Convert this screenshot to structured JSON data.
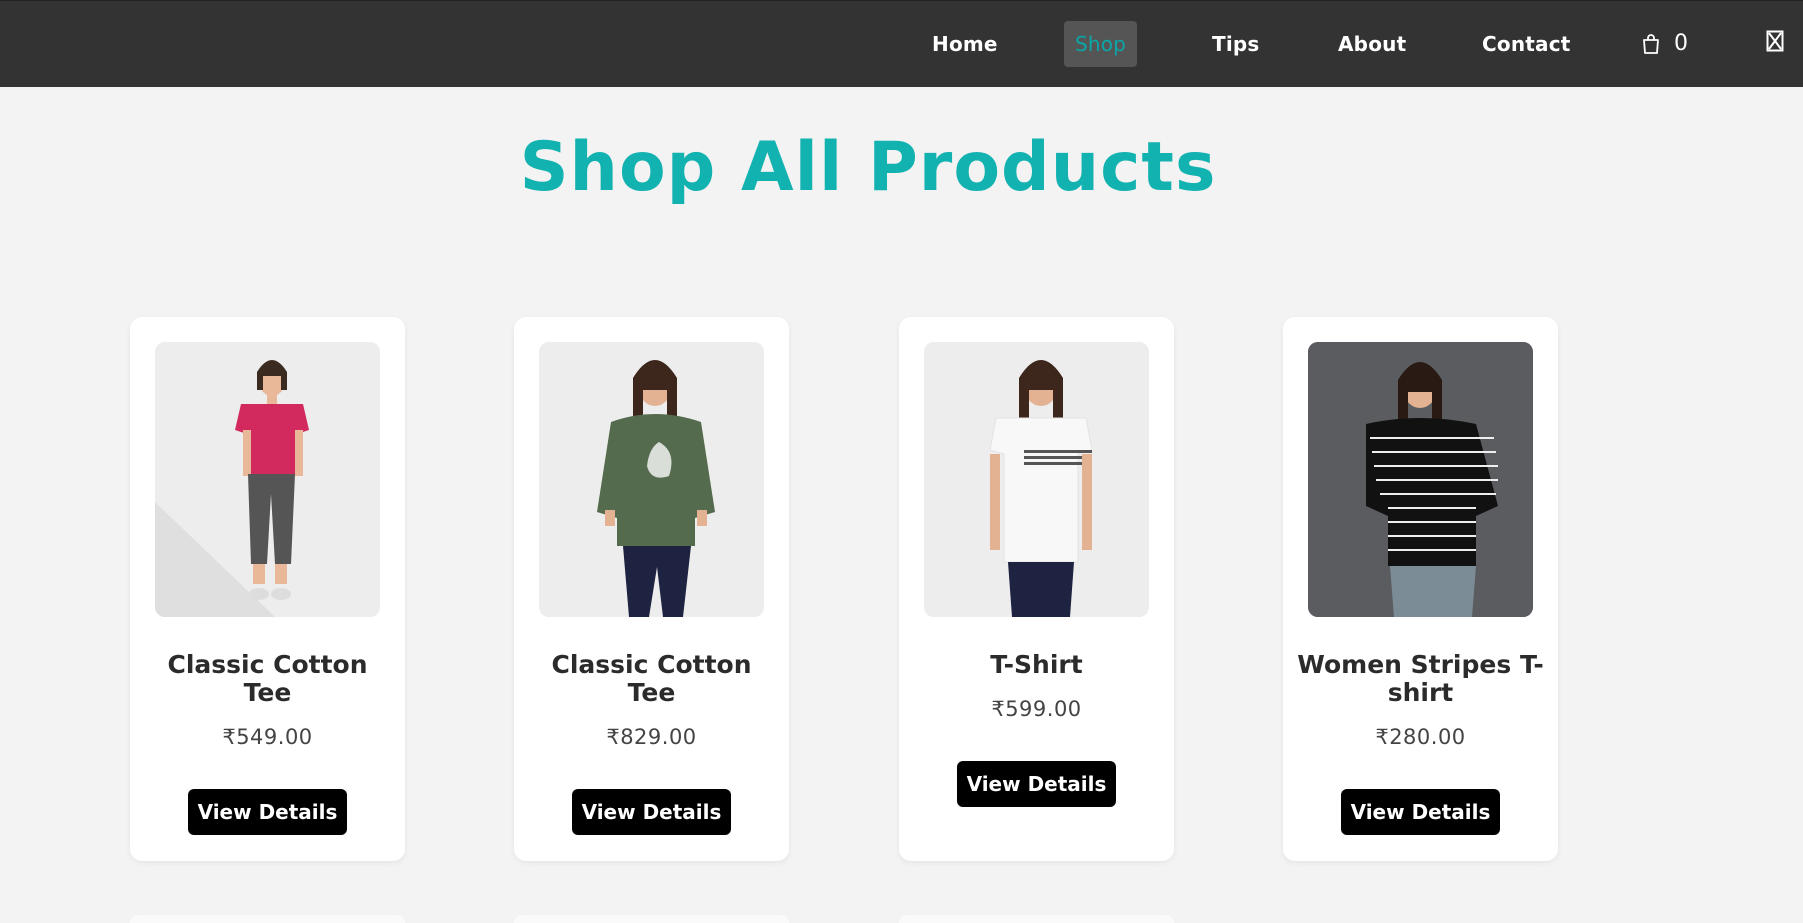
{
  "nav": {
    "items": [
      {
        "label": "Home",
        "active": false
      },
      {
        "label": "Shop",
        "active": true
      },
      {
        "label": "Tips",
        "active": false
      },
      {
        "label": "About",
        "active": false
      },
      {
        "label": "Contact",
        "active": false
      }
    ],
    "cart_count": "0",
    "cart_icon": "shopping-bag-icon",
    "close_icon": "close-icon"
  },
  "page": {
    "title": "Shop All Products"
  },
  "products": [
    {
      "name": "Classic Cotton Tee",
      "price": "₹549.00",
      "button": "View Details",
      "shirt_color": "#d2295f",
      "pants_color": "#555555",
      "image_bg": "#efefef"
    },
    {
      "name": "Classic Cotton Tee",
      "price": "₹829.00",
      "button": "View Details",
      "shirt_color": "#556b4d",
      "pants_color": "#1d2340",
      "image_bg": "#efefef"
    },
    {
      "name": "T-Shirt",
      "price": "₹599.00",
      "button": "View Details",
      "shirt_color": "#f6f6f6",
      "pants_color": "#1d2340",
      "image_bg": "#efefef"
    },
    {
      "name": "Women Stripes T-shirt",
      "price": "₹280.00",
      "button": "View Details",
      "shirt_color": "#111111",
      "pants_color": "#7b8c97",
      "image_bg": "#5a5c5f"
    }
  ],
  "colors": {
    "navbar_bg": "#333333",
    "accent": "#12b2b0",
    "page_bg": "#f3f3f3",
    "button_bg": "#000000"
  }
}
